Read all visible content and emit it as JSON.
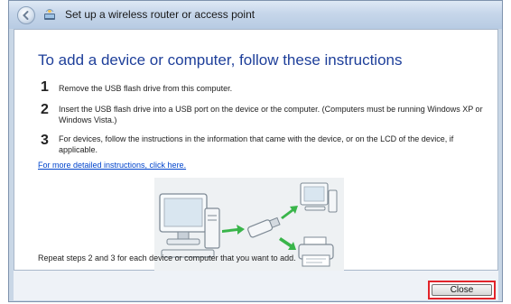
{
  "window": {
    "title": "Set up a wireless router or access point"
  },
  "content": {
    "heading": "To add a device or computer, follow these instructions",
    "steps": [
      {
        "number": "1",
        "text": "Remove the USB flash drive from this computer."
      },
      {
        "number": "2",
        "text": "Insert the USB flash drive into a USB port on the device or the computer. (Computers must be running Windows XP or Windows Vista.)"
      },
      {
        "number": "3",
        "text": "For devices, follow the instructions in the information that came with the device, or on the LCD of the device, if applicable."
      }
    ],
    "link_text": "For more detailed instructions, click here.",
    "repeat_text": "Repeat steps 2 and 3 for each device or computer that you want to add."
  },
  "footer": {
    "close_label": "Close"
  },
  "icons": {
    "back": "back-arrow-icon",
    "app": "network-setup-icon",
    "illustration": "usb-transfer-illustration"
  },
  "colors": {
    "heading": "#1e3f9a",
    "link": "#0044cc",
    "highlight": "#e2242a"
  }
}
